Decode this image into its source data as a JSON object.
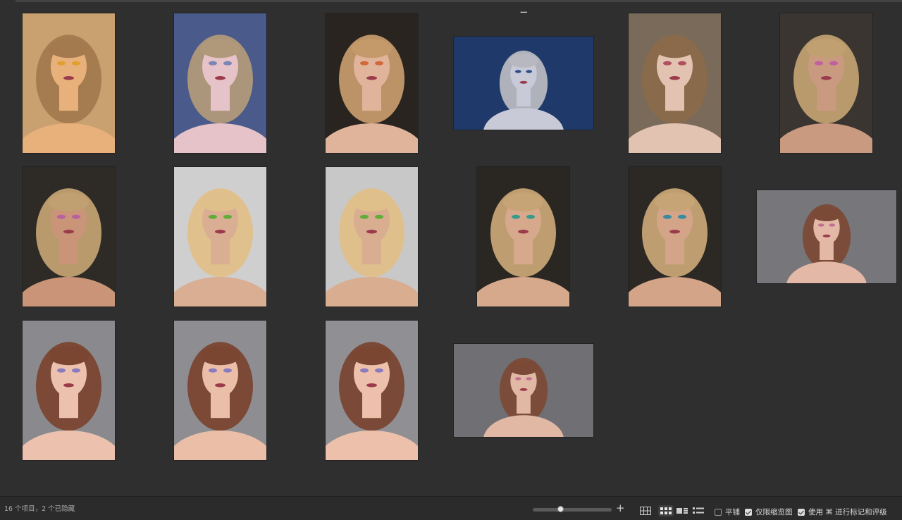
{
  "status": {
    "count_text": "16 个项目，2 个已隐藏"
  },
  "toolbar": {
    "zoom_minus": "−",
    "zoom_plus": "+",
    "zoom_level": 0.35,
    "view_modes": [
      "grid-large-icon",
      "grid-small-icon",
      "filmstrip-icon",
      "list-icon"
    ],
    "active_view": "grid-small-icon",
    "tile_label": "平铺",
    "tile_checked": false,
    "thumb_only_label": "仅限缩览图",
    "thumb_only_checked": true,
    "use_label": "使用 ⌘ 进行标记和评级",
    "use_checked": true
  },
  "photos": [
    {
      "name": "photo-colorful-paint-face",
      "orientation": "portrait",
      "bg": "#c9a070",
      "skin": "#e8b07a",
      "hair": "#a27a4d",
      "accent": "#e0a030"
    },
    {
      "name": "photo-long-hair-blue-backdrop",
      "orientation": "portrait",
      "bg": "#4a5a8a",
      "skin": "#e6c3c8",
      "hair": "#b0997a",
      "accent": "#7a86b5"
    },
    {
      "name": "photo-braid-orange-eyeshadow",
      "orientation": "portrait",
      "bg": "#2a2420",
      "skin": "#e0b49a",
      "hair": "#c49a6a",
      "accent": "#d06a3a"
    },
    {
      "name": "photo-silver-hair-blue-studio",
      "orientation": "landscape",
      "bg": "#1f3a6a",
      "skin": "#c9cad8",
      "hair": "#b8b8c0",
      "accent": "#2e4f86"
    },
    {
      "name": "photo-glitter-face-messy-hair",
      "orientation": "portrait",
      "bg": "#7a6a5a",
      "skin": "#e2c2b0",
      "hair": "#8a6a4a",
      "accent": "#b05060"
    },
    {
      "name": "photo-pompom-hair-pose",
      "orientation": "portrait",
      "bg": "#3a3530",
      "skin": "#c99a80",
      "hair": "#c0a070",
      "accent": "#c060a0"
    },
    {
      "name": "photo-pompom-hair-shoulder",
      "orientation": "portrait",
      "bg": "#2e2a26",
      "skin": "#c99478",
      "hair": "#c0a070",
      "accent": "#b860a0"
    },
    {
      "name": "photo-blonde-bob-green-eyes-front",
      "orientation": "portrait",
      "bg": "#cfcfcf",
      "skin": "#d9ae92",
      "hair": "#e0c08a",
      "accent": "#5fae3a"
    },
    {
      "name": "photo-blonde-bob-green-eyes-side",
      "orientation": "portrait",
      "bg": "#c8c8c8",
      "skin": "#d8ad90",
      "hair": "#e0c08a",
      "accent": "#5fae3a"
    },
    {
      "name": "photo-felt-balls-hair-front",
      "orientation": "portrait",
      "bg": "#2a2622",
      "skin": "#d6a98c",
      "hair": "#c6a475",
      "accent": "#3a9a8a"
    },
    {
      "name": "photo-felt-balls-hair-side",
      "orientation": "portrait",
      "bg": "#2c2824",
      "skin": "#d3a488",
      "hair": "#c6a475",
      "accent": "#3a8aa0"
    },
    {
      "name": "photo-brunette-gray-studio",
      "orientation": "landscape",
      "bg": "#77767b",
      "skin": "#e3b8a6",
      "hair": "#7a4a36",
      "accent": "#c07090"
    },
    {
      "name": "photo-brunette-purple-eyeshadow-1",
      "orientation": "portrait",
      "bg": "#8a8a8e",
      "skin": "#ecc1ad",
      "hair": "#7a4632",
      "accent": "#8a7ac0"
    },
    {
      "name": "photo-brunette-purple-eyeshadow-2",
      "orientation": "portrait",
      "bg": "#8e8e92",
      "skin": "#ebbea8",
      "hair": "#7a4632",
      "accent": "#8a7ac0"
    },
    {
      "name": "photo-brunette-purple-eyeshadow-3",
      "orientation": "portrait",
      "bg": "#909094",
      "skin": "#ecc0aa",
      "hair": "#7a4632",
      "accent": "#8a7ac0"
    },
    {
      "name": "photo-brunette-arms-raised",
      "orientation": "landscape",
      "bg": "#6f6f74",
      "skin": "#e0b8a4",
      "hair": "#7a4a36",
      "accent": "#c07090"
    }
  ]
}
